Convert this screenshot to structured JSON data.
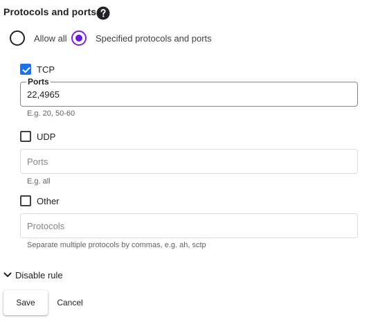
{
  "section": {
    "title": "Protocols and ports",
    "help_icon": "help-circle-icon"
  },
  "radios": {
    "allow_all_label": "Allow all",
    "specified_label": "Specified protocols and ports",
    "selected": "specified"
  },
  "tcp": {
    "label": "TCP",
    "checked": true,
    "field_label": "Ports",
    "value": "22,4965",
    "hint": "E.g. 20, 50-60"
  },
  "udp": {
    "label": "UDP",
    "checked": false,
    "placeholder": "Ports",
    "hint": "E.g. all"
  },
  "other": {
    "label": "Other",
    "checked": false,
    "placeholder": "Protocols",
    "hint": "Separate multiple protocols by commas, e.g. ah, sctp"
  },
  "disable_rule": {
    "label": "Disable rule",
    "icon": "chevron-down-icon"
  },
  "actions": {
    "save_label": "Save",
    "cancel_label": "Cancel"
  },
  "colors": {
    "accent_radio": "#6b18e0",
    "checkbox_blue": "#1a73e8"
  }
}
